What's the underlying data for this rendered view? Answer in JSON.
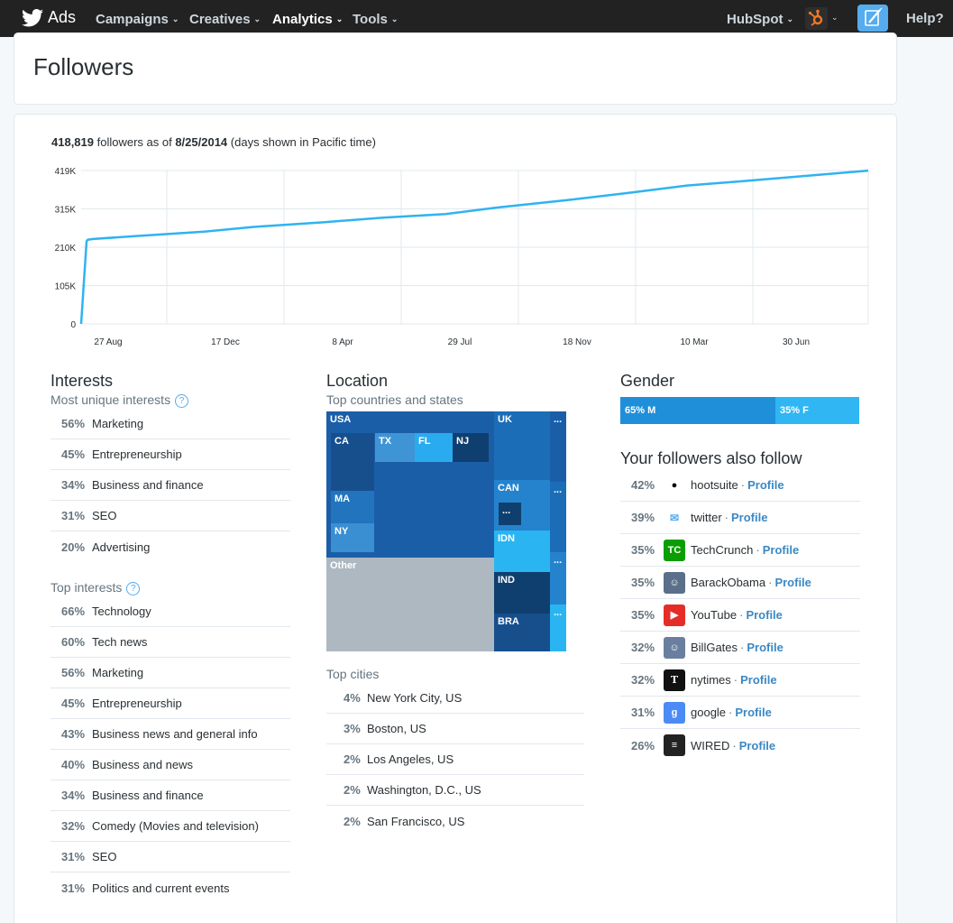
{
  "nav": {
    "logo_text": "Ads",
    "items": [
      {
        "label": "Campaigns",
        "caret": "⌄"
      },
      {
        "label": "Creatives",
        "caret": "⌄"
      },
      {
        "label": "Analytics",
        "caret": "⌄"
      },
      {
        "label": "Tools",
        "caret": "⌄"
      }
    ],
    "account": "HubSpot",
    "help": "Help?"
  },
  "page": {
    "title": "Followers"
  },
  "summary": {
    "count": "418,819",
    "mid": " followers as of ",
    "date": "8/25/2014",
    "note": " (days shown in Pacific time)"
  },
  "chart_data": {
    "type": "line",
    "y_tick_labels": [
      "0",
      "105K",
      "210K",
      "315K",
      "419K"
    ],
    "ylim": [
      0,
      419000
    ],
    "x_tick_labels": [
      "27 Aug",
      "17 Dec",
      "8 Apr",
      "29 Jul",
      "18 Nov",
      "10 Mar",
      "30 Jun"
    ],
    "grid": true,
    "color": "#2fb3f0",
    "series": [
      {
        "x": [
          "2012-08-25",
          "2012-08-30",
          "2012-08-31",
          "2012-09-05",
          "2012-10-15",
          "2012-12-17",
          "2013-02-01",
          "2013-04-08",
          "2013-06-01",
          "2013-07-29",
          "2013-09-15",
          "2013-11-18",
          "2014-01-15",
          "2014-03-10",
          "2014-05-01",
          "2014-06-30",
          "2014-08-25"
        ],
        "y": [
          0,
          225000,
          230000,
          232000,
          240000,
          252000,
          265000,
          278000,
          290000,
          300000,
          318000,
          338000,
          358000,
          378000,
          390000,
          405000,
          418819
        ]
      }
    ]
  },
  "interests": {
    "title": "Interests",
    "unique_sub": "Most unique interests",
    "unique": [
      {
        "pct": "56%",
        "label": "Marketing"
      },
      {
        "pct": "45%",
        "label": "Entrepreneurship"
      },
      {
        "pct": "34%",
        "label": "Business and finance"
      },
      {
        "pct": "31%",
        "label": "SEO"
      },
      {
        "pct": "20%",
        "label": "Advertising"
      }
    ],
    "top_sub": "Top interests",
    "top": [
      {
        "pct": "66%",
        "label": "Technology"
      },
      {
        "pct": "60%",
        "label": "Tech news"
      },
      {
        "pct": "56%",
        "label": "Marketing"
      },
      {
        "pct": "45%",
        "label": "Entrepreneurship"
      },
      {
        "pct": "43%",
        "label": "Business news and general info"
      },
      {
        "pct": "40%",
        "label": "Business and news"
      },
      {
        "pct": "34%",
        "label": "Business and finance"
      },
      {
        "pct": "32%",
        "label": "Comedy (Movies and television)"
      },
      {
        "pct": "31%",
        "label": "SEO"
      },
      {
        "pct": "31%",
        "label": "Politics and current events"
      }
    ]
  },
  "location": {
    "title": "Location",
    "sub": "Top countries and states",
    "treemap_labels": {
      "usa": "USA",
      "ca": "CA",
      "tx": "TX",
      "fl": "FL",
      "nj": "NJ",
      "ma": "MA",
      "ny": "NY",
      "uk": "UK",
      "can": "CAN",
      "more1": "...",
      "idn": "IDN",
      "ind": "IND",
      "bra": "BRA",
      "other": "Other",
      "dots": "..."
    },
    "cities_sub": "Top cities",
    "cities": [
      {
        "pct": "4%",
        "label": "New York City, US"
      },
      {
        "pct": "3%",
        "label": "Boston, US"
      },
      {
        "pct": "2%",
        "label": "Los Angeles, US"
      },
      {
        "pct": "2%",
        "label": "Washington, D.C., US"
      },
      {
        "pct": "2%",
        "label": "San Francisco, US"
      }
    ]
  },
  "gender": {
    "title": "Gender",
    "male_label": "65% M",
    "male_pct": 65,
    "female_label": "35% F",
    "female_pct": 35
  },
  "follows": {
    "title": "Your followers also follow",
    "link_label": "Profile",
    "separator": "·",
    "items": [
      {
        "pct": "42%",
        "name": "hootsuite",
        "icon": "owl-icon",
        "color": "#ffffff"
      },
      {
        "pct": "39%",
        "name": "twitter",
        "icon": "twitter-bird-icon",
        "color": "#ffffff"
      },
      {
        "pct": "35%",
        "name": "TechCrunch",
        "icon": "techcrunch-icon",
        "color": "#0a9e01"
      },
      {
        "pct": "35%",
        "name": "BarackObama",
        "icon": "person-photo-icon",
        "color": "#5b6f8a"
      },
      {
        "pct": "35%",
        "name": "YouTube",
        "icon": "youtube-icon",
        "color": "#e52d27"
      },
      {
        "pct": "32%",
        "name": "BillGates",
        "icon": "person-photo-icon",
        "color": "#6a7fa0"
      },
      {
        "pct": "32%",
        "name": "nytimes",
        "icon": "nyt-icon",
        "color": "#111111"
      },
      {
        "pct": "31%",
        "name": "google",
        "icon": "google-icon",
        "color": "#4c8bf5"
      },
      {
        "pct": "26%",
        "name": "WIRED",
        "icon": "wired-icon",
        "color": "#222222"
      }
    ]
  }
}
